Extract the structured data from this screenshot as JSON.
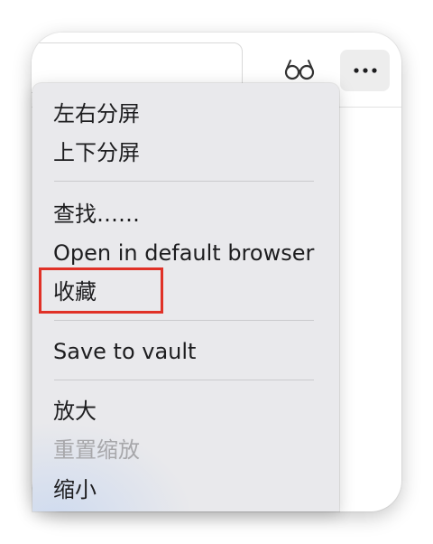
{
  "toolbar": {
    "reader_icon": "reader-glasses-icon",
    "more_icon": "more-dots-icon"
  },
  "menu": {
    "items": [
      {
        "label": "左右分屏",
        "enabled": true
      },
      {
        "label": "上下分屏",
        "enabled": true
      },
      {
        "label": "查找……",
        "enabled": true
      },
      {
        "label": "Open in default browser",
        "enabled": true
      },
      {
        "label": "收藏",
        "enabled": true
      },
      {
        "label": "Save to vault",
        "enabled": true
      },
      {
        "label": "放大",
        "enabled": true
      },
      {
        "label": "重置缩放",
        "enabled": false
      },
      {
        "label": "缩小",
        "enabled": true
      }
    ]
  },
  "annotation": {
    "highlight_color": "#e03127",
    "highlighted_item": "收藏"
  }
}
